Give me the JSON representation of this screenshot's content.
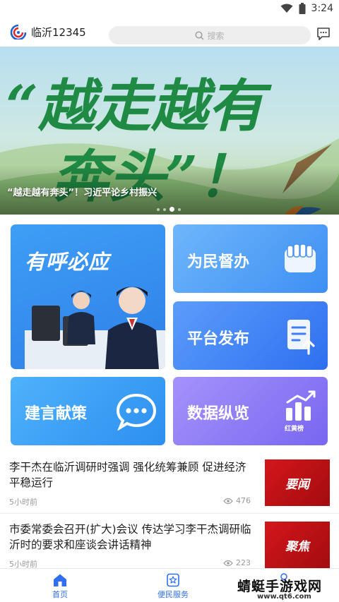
{
  "status_bar": {
    "time": "3:24"
  },
  "header": {
    "app_title": "临沂12345",
    "search_placeholder": "搜索"
  },
  "banner": {
    "caption": "“越走越有奔头”！习近平论乡村振兴",
    "art_text_line1": "“越走越有",
    "art_text_line2": "奔头”！",
    "dots_count": 4,
    "active_dot": 2
  },
  "tiles": {
    "hotline": "有呼必应",
    "supervise": "为民督办",
    "publish": "平台发布",
    "advice": "建言献策",
    "data": "数据纵览",
    "rank_label": "红黄榜"
  },
  "news": [
    {
      "title": "李干杰在临沂调研时强调  强化统筹兼顾  促进经济平稳运行",
      "time": "5小时前",
      "views": "476",
      "thumb_text": "要闻"
    },
    {
      "title": "市委常委会召开(扩大)会议  传达学习李干杰调研临沂时的要求和座谈会讲话精神",
      "time": "5小时前",
      "views": "223",
      "thumb_text": "聚焦"
    }
  ],
  "bottom_nav": {
    "home": "首页",
    "service": "便民服务"
  },
  "watermark": {
    "text": "蜻蜓手游戏网",
    "url": "www.qt6.com"
  },
  "colors": {
    "accent": "#2f6ff0",
    "tile_blue": "#3d8ff3",
    "tile_purple": "#7867f0",
    "news_red": "#d3161b"
  }
}
